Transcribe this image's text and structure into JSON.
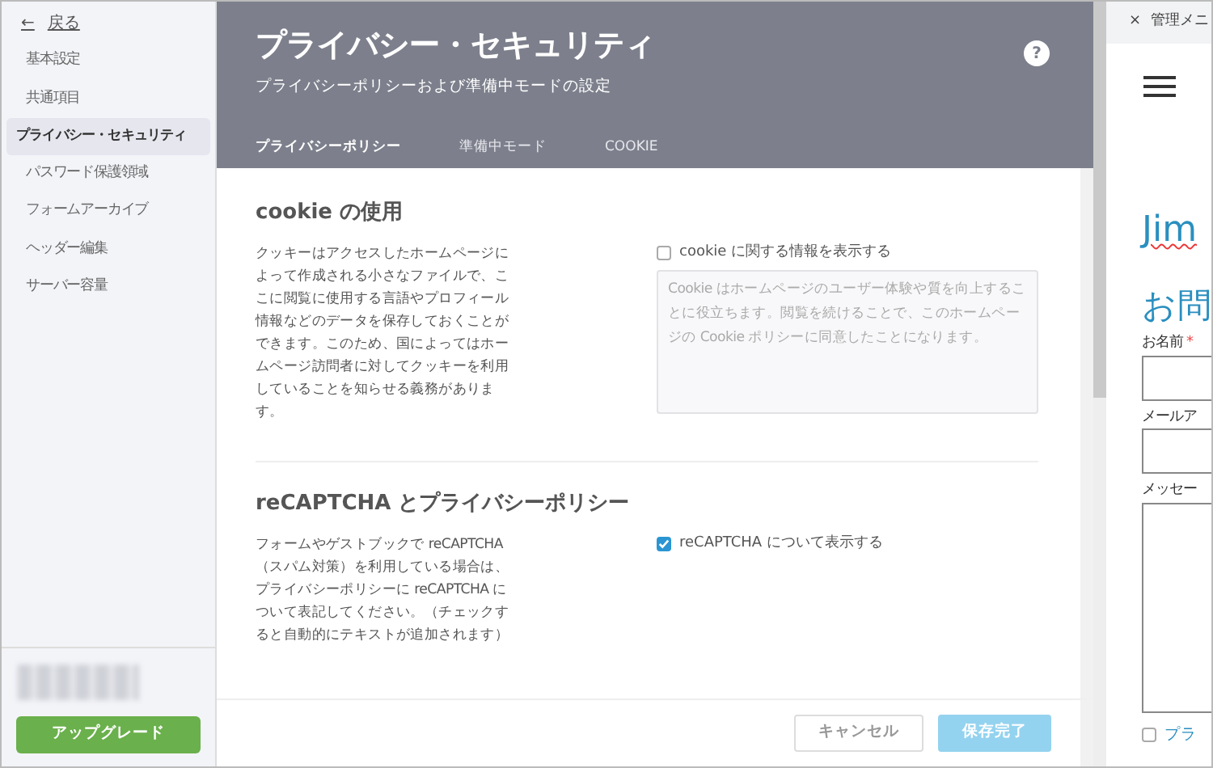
{
  "sidebar": {
    "back": {
      "arrow": "←",
      "label": "戻る"
    },
    "items": [
      {
        "label": "基本設定",
        "selected": false
      },
      {
        "label": "共通項目",
        "selected": false
      },
      {
        "label": "プライバシー・セキュリティ",
        "selected": true
      },
      {
        "label": "パスワード保護領域",
        "selected": false
      },
      {
        "label": "フォームアーカイブ",
        "selected": false
      },
      {
        "label": "ヘッダー編集",
        "selected": false
      },
      {
        "label": "サーバー容量",
        "selected": false
      }
    ],
    "upgrade_button": "アップグレード"
  },
  "header": {
    "title": "プライバシー・セキュリティ",
    "subtitle": "プライバシーポリシーおよび準備中モードの設定",
    "help": "?",
    "tabs": [
      {
        "label": "プライバシーポリシー",
        "selected": true
      },
      {
        "label": "準備中モード",
        "selected": false
      },
      {
        "label": "COOKIE",
        "selected": false
      }
    ]
  },
  "sections": [
    {
      "title": "cookie の使用",
      "description": "クッキーはアクセスしたホームページによって作成される小さなファイルで、ここに閲覧に使用する言語やプロフィール情報などのデータを保存しておくことができます。このため、国によってはホームページ訪問者に対してクッキーを利用していることを知らせる義務があります。",
      "option": {
        "label": "cookie に関する情報を表示する",
        "checked": false
      },
      "notice": {
        "value": "Cookie はホームページのユーザー体験や質を向上することに役立ちます。閲覧を続けることで、このホームページの Cookie ポリシーに同意したことになります。",
        "disabled": true
      }
    },
    {
      "title": "reCAPTCHA とプライバシーポリシー",
      "description": "フォームやゲストブックで reCAPTCHA（スパム対策）を利用している場合は、プライバシーポリシーに reCAPTCHA について表記してください。（チェックすると自動的にテキストが追加されます）",
      "option": {
        "label": "reCAPTCHA について表示する",
        "checked": true
      }
    }
  ],
  "footer": {
    "buttons": [
      {
        "label": "キャンセル",
        "kind": "cancel",
        "disabled": false
      },
      {
        "label": "保存完了",
        "kind": "save",
        "disabled": true
      }
    ]
  },
  "preview": {
    "tab": {
      "close": "×",
      "title": "管理メニ"
    },
    "site_title": "Jim",
    "heading": "お問",
    "fields": [
      {
        "label": "お名前",
        "required": true,
        "required_mark": "*",
        "kind": "input"
      },
      {
        "label": "メールア",
        "kind": "input"
      },
      {
        "label": "メッセー",
        "kind": "textarea"
      }
    ],
    "consent": {
      "label": "プラ",
      "checked": false
    }
  }
}
